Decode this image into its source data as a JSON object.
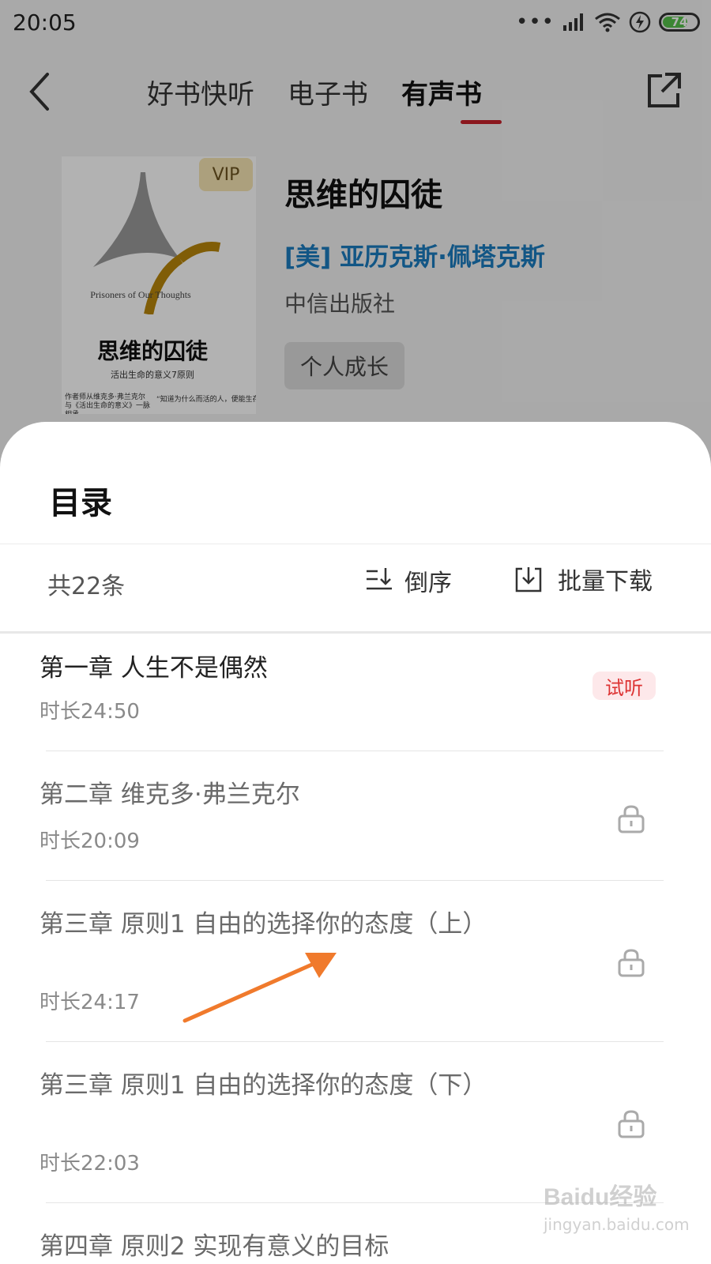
{
  "status_bar": {
    "time": "20:05",
    "battery": "74",
    "battery_level": 0.74
  },
  "nav": {
    "tabs": [
      "好书快听",
      "电子书",
      "有声书"
    ],
    "active_tab": "有声书"
  },
  "book": {
    "vip_label": "VIP",
    "title": "思维的囚徒",
    "author": "[美] 亚历克斯·佩塔克斯",
    "publisher": "中信出版社",
    "tag": "个人成长",
    "cover": {
      "english_title": "Prisoners of Our Thoughts",
      "title": "思维的囚徒",
      "subtitle": "活出生命的意义7原则",
      "quote_left": "作者师从维克多·弗兰克尔 与《活出生命的意义》一脉相承",
      "quote_right": "“知道为什么而活的人，便能生存”"
    }
  },
  "catalog": {
    "title": "目录",
    "count": "共22条",
    "sort_label": "倒序",
    "download_label": "批量下载",
    "chapters": [
      {
        "title": "第一章 人生不是偶然",
        "duration": "时长24:50",
        "badge": "试听"
      },
      {
        "title": "第二章 维克多·弗兰克尔",
        "duration": "时长20:09"
      },
      {
        "title": "第三章 原则1 自由的选择你的态度（上）",
        "duration": "时长24:17"
      },
      {
        "title": "第三章 原则1 自由的选择你的态度（下）",
        "duration": "时长22:03"
      },
      {
        "title": "第四章 原则2 实现有意义的目标"
      }
    ]
  },
  "colors": {
    "accent_red": "#c8222b",
    "author_blue": "#1a7bbf",
    "arrow_orange": "#f07a2c",
    "vip_gold": "#f6e5b4"
  },
  "watermark": {
    "text": "Baidu经验",
    "sub": "jingyan.baidu.com"
  }
}
